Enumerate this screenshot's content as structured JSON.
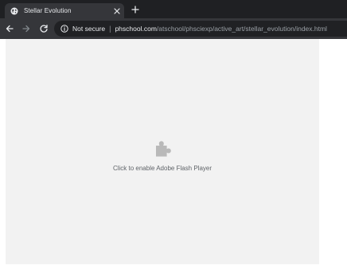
{
  "browser": {
    "tab": {
      "title": "Stellar Evolution",
      "favicon": "globe-icon",
      "close_icon": "close-icon"
    },
    "new_tab_icon": "plus-icon",
    "nav": {
      "back_icon": "arrow-left-icon",
      "forward_icon": "arrow-right-icon",
      "reload_icon": "reload-icon"
    },
    "address_bar": {
      "info_icon": "info-icon",
      "security_label": "Not secure",
      "separator": "|",
      "url_host": "phschool.com",
      "url_path": "/atschool/phsciexp/active_art/stellar_evolution/index.html"
    }
  },
  "page": {
    "plugin_icon": "puzzle-piece-icon",
    "plugin_message": "Click to enable Adobe Flash Player"
  },
  "colors": {
    "tabstrip_bg": "#1f2023",
    "toolbar_bg": "#35363a",
    "omnibox_bg": "#202124",
    "plugin_bg": "#f2f2f2",
    "plugin_icon_color": "#b9b9b9"
  }
}
